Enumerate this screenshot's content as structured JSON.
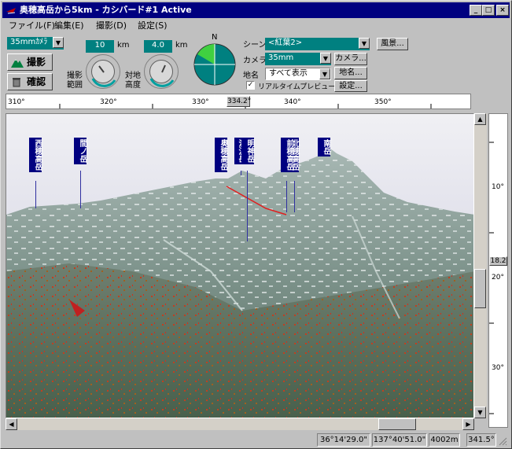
{
  "window": {
    "title": "奥穂高岳から5km - カシバード#1 Active",
    "minimize": "_",
    "maximize": "□",
    "close": "×"
  },
  "menu": [
    "ファイル(F)",
    "編集(E)",
    "撮影(D)",
    "設定(S)"
  ],
  "toolbar": {
    "camera_type": "35mmｶﾒﾗ",
    "shoot_label": "撮影",
    "confirm_label": "確認",
    "distance_value": "10",
    "distance_unit": "km",
    "distance_label_1": "撮影",
    "distance_label_2": "範囲",
    "height_value": "4.0",
    "height_unit": "km",
    "height_label_1": "対地",
    "height_label_2": "高度",
    "compass_n": "N",
    "scene_label": "シーン",
    "scene_value": "<紅葉2>",
    "scenery_button": "風景...",
    "camera_label": "カメラ",
    "camera_value": "35mm",
    "camera_button": "カメラ...",
    "placename_label": "地名",
    "placename_value": "すべて表示",
    "placename_button": "地名...",
    "realtime_label": "リアルタイムプレビュー",
    "settings_button": "設定..."
  },
  "hruler": {
    "ticks": [
      "310°",
      "320°",
      "330°",
      "340°",
      "350°"
    ],
    "current": "334.2°"
  },
  "vruler": {
    "ticks": [
      "10°",
      "20°",
      "30°"
    ],
    "current": "18.2"
  },
  "peaks": [
    {
      "name": "西穂高岳"
    },
    {
      "name": "間ノ岳"
    },
    {
      "name": "奥穂高岳"
    },
    {
      "name": "涸沢岳"
    },
    {
      "name": "明神岳"
    },
    {
      "name": "北穂高岳"
    },
    {
      "name": "前穂高岳"
    },
    {
      "name": "南岳"
    }
  ],
  "status": {
    "lat": "36°14'29.0\"",
    "lon": "137°40'51.0\"",
    "alt": "4002m",
    "dir": "341.5°"
  },
  "colors": {
    "titlebar": "#000080",
    "teal_field": "#008080",
    "peak_label": "#000080",
    "compass_green": "#40d040",
    "compass_teal": "#008080"
  }
}
